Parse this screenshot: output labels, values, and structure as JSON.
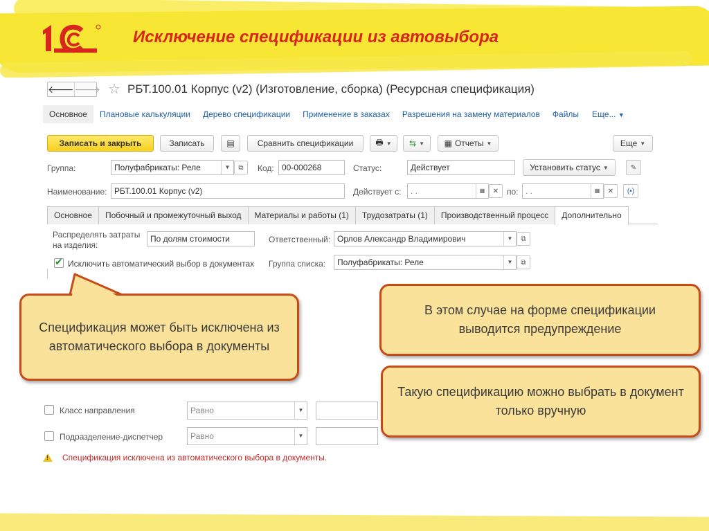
{
  "slide": {
    "title": "Исключение спецификации из автовыбора"
  },
  "window": {
    "title": "РБТ.100.01 Корпус (v2) (Изготовление, сборка) (Ресурсная спецификация)"
  },
  "top_tabs": [
    "Основное",
    "Плановые калькуляции",
    "Дерево спецификации",
    "Применение в заказах",
    "Разрешения на замену материалов",
    "Файлы"
  ],
  "top_tabs_more": "Еще...",
  "toolbar": {
    "save_close": "Записать и закрыть",
    "save": "Записать",
    "compare": "Сравнить спецификации",
    "reports": "Отчеты",
    "more": "Еще"
  },
  "form": {
    "group_label": "Группа:",
    "group_value": "Полуфабрикаты: Реле",
    "code_label": "Код:",
    "code_value": "00-000268",
    "status_label": "Статус:",
    "status_value": "Действует",
    "set_status": "Установить статус",
    "name_label": "Наименование:",
    "name_value": "РБТ.100.01 Корпус (v2)",
    "valid_from_label": "Действует с:",
    "date_placeholder": ".  .",
    "to_label": "по:"
  },
  "inner_tabs": [
    "Основное",
    "Побочный и промежуточный выход",
    "Материалы и работы (1)",
    "Трудозатраты (1)",
    "Производственный процесс",
    "Дополнительно"
  ],
  "extra": {
    "distribute_label_1": "Распределять затраты",
    "distribute_label_2": "на изделия:",
    "distribute_value": "По долям стоимости",
    "responsible_label": "Ответственный:",
    "responsible_value": "Орлов Александр Владимирович",
    "exclude_checkbox": "Исключить автоматический выбор в документах",
    "list_group_label": "Группа списка:",
    "list_group_value": "Полуфабрикаты: Реле"
  },
  "filters": [
    {
      "label": "Класс направления",
      "condition": "Равно"
    },
    {
      "label": "Подразделение-диспетчер",
      "condition": "Равно"
    }
  ],
  "warning": "Спецификация исключена из автоматического выбора в документы.",
  "callouts": {
    "left": "Спецификация может быть исключена из автоматического выбора в документы",
    "right_top": "В этом случае на форме спецификации выводится предупреждение",
    "right_bottom": "Такую спецификацию можно выбрать в документ только вручную"
  },
  "colors": {
    "accent_yellow": "#f7e634",
    "brand_red": "#d9261c",
    "callout_border": "#c84b17",
    "callout_fill": "#fbe29a",
    "link": "#1f5fa6",
    "warning_text": "#c62828"
  }
}
